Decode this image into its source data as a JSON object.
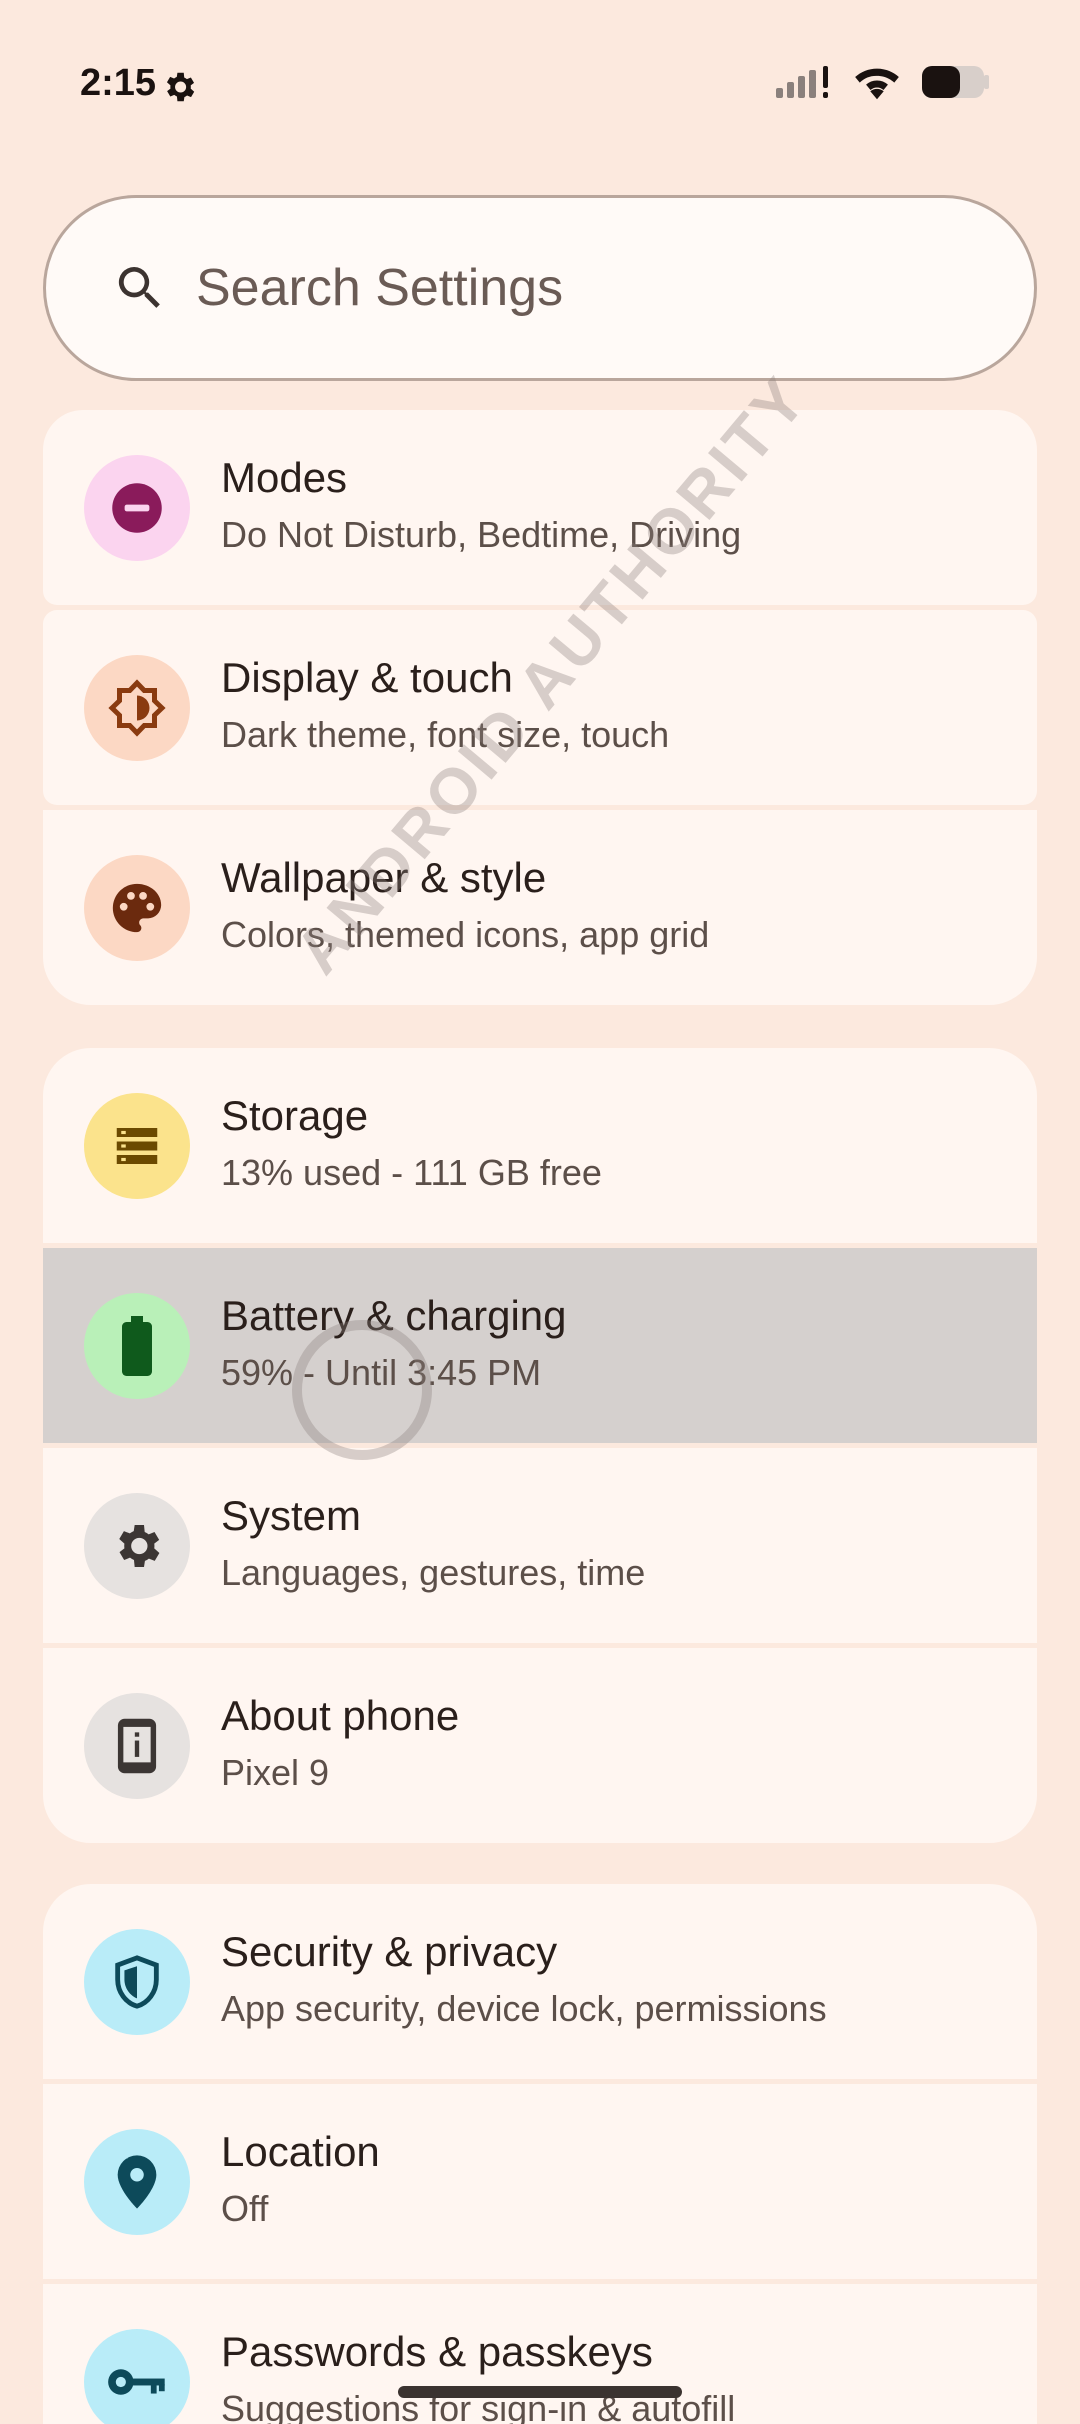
{
  "status": {
    "time": "2:15"
  },
  "search": {
    "placeholder": "Search Settings"
  },
  "groups": [
    {
      "items": [
        {
          "title": "Modes",
          "subtitle": "Do Not Disturb, Bedtime, Driving",
          "icon": "minus-circle-icon",
          "bg": "#fbd4ef",
          "fg": "#8a1b5b"
        },
        {
          "title": "Display & touch",
          "subtitle": "Dark theme, font size, touch",
          "icon": "brightness-icon",
          "bg": "#fcd8c4",
          "fg": "#8a3b10"
        },
        {
          "title": "Wallpaper & style",
          "subtitle": "Colors, themed icons, app grid",
          "icon": "palette-icon",
          "bg": "#fcd8c4",
          "fg": "#6b2a0e"
        }
      ]
    },
    {
      "items": [
        {
          "title": "Storage",
          "subtitle": "13% used - 111 GB free",
          "icon": "storage-icon",
          "bg": "#fbe38c",
          "fg": "#6b4a00"
        },
        {
          "title": "Battery & charging",
          "subtitle": "59% - Until 3:45 PM",
          "icon": "battery-icon",
          "bg": "#b9f0b8",
          "fg": "#0f5a1c"
        },
        {
          "title": "System",
          "subtitle": "Languages, gestures, time",
          "icon": "gear-icon",
          "bg": "#e6e2e0",
          "fg": "#3c3634"
        },
        {
          "title": "About phone",
          "subtitle": "Pixel 9",
          "icon": "phone-info-icon",
          "bg": "#e6e2e0",
          "fg": "#3c3634"
        }
      ]
    },
    {
      "items": [
        {
          "title": "Security & privacy",
          "subtitle": "App security, device lock, permissions",
          "icon": "shield-icon",
          "bg": "#b9ecf8",
          "fg": "#0d4a5a"
        },
        {
          "title": "Location",
          "subtitle": "Off",
          "icon": "location-pin-icon",
          "bg": "#b9ecf8",
          "fg": "#0d4a5a"
        },
        {
          "title": "Passwords & passkeys",
          "subtitle": "Suggestions for sign-in & autofill",
          "icon": "key-icon",
          "bg": "#b9ecf8",
          "fg": "#0d4a5a"
        }
      ]
    }
  ],
  "watermark": "ANDROID AUTHORITY"
}
